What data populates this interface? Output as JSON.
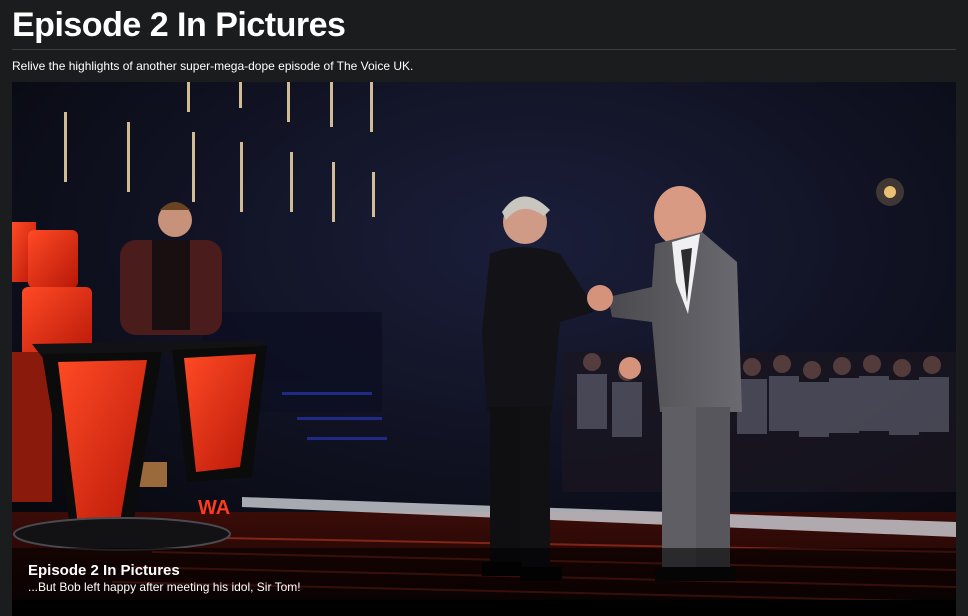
{
  "page": {
    "title": "Episode 2 In Pictures",
    "subtitle": "Relive the highlights of another super-mega-dope episode of The Voice UK."
  },
  "gallery": {
    "photo_alt": "Tom Jones shaking hands with Bob on The Voice UK stage",
    "caption": {
      "title": "Episode 2 In Pictures",
      "text": "...But Bob left happy after meeting his idol, Sir Tom!"
    },
    "stage_sign": "WA"
  },
  "colors": {
    "background": "#1a1c1e",
    "chair_red": "#e02a12",
    "stage_dark": "#07080c"
  }
}
